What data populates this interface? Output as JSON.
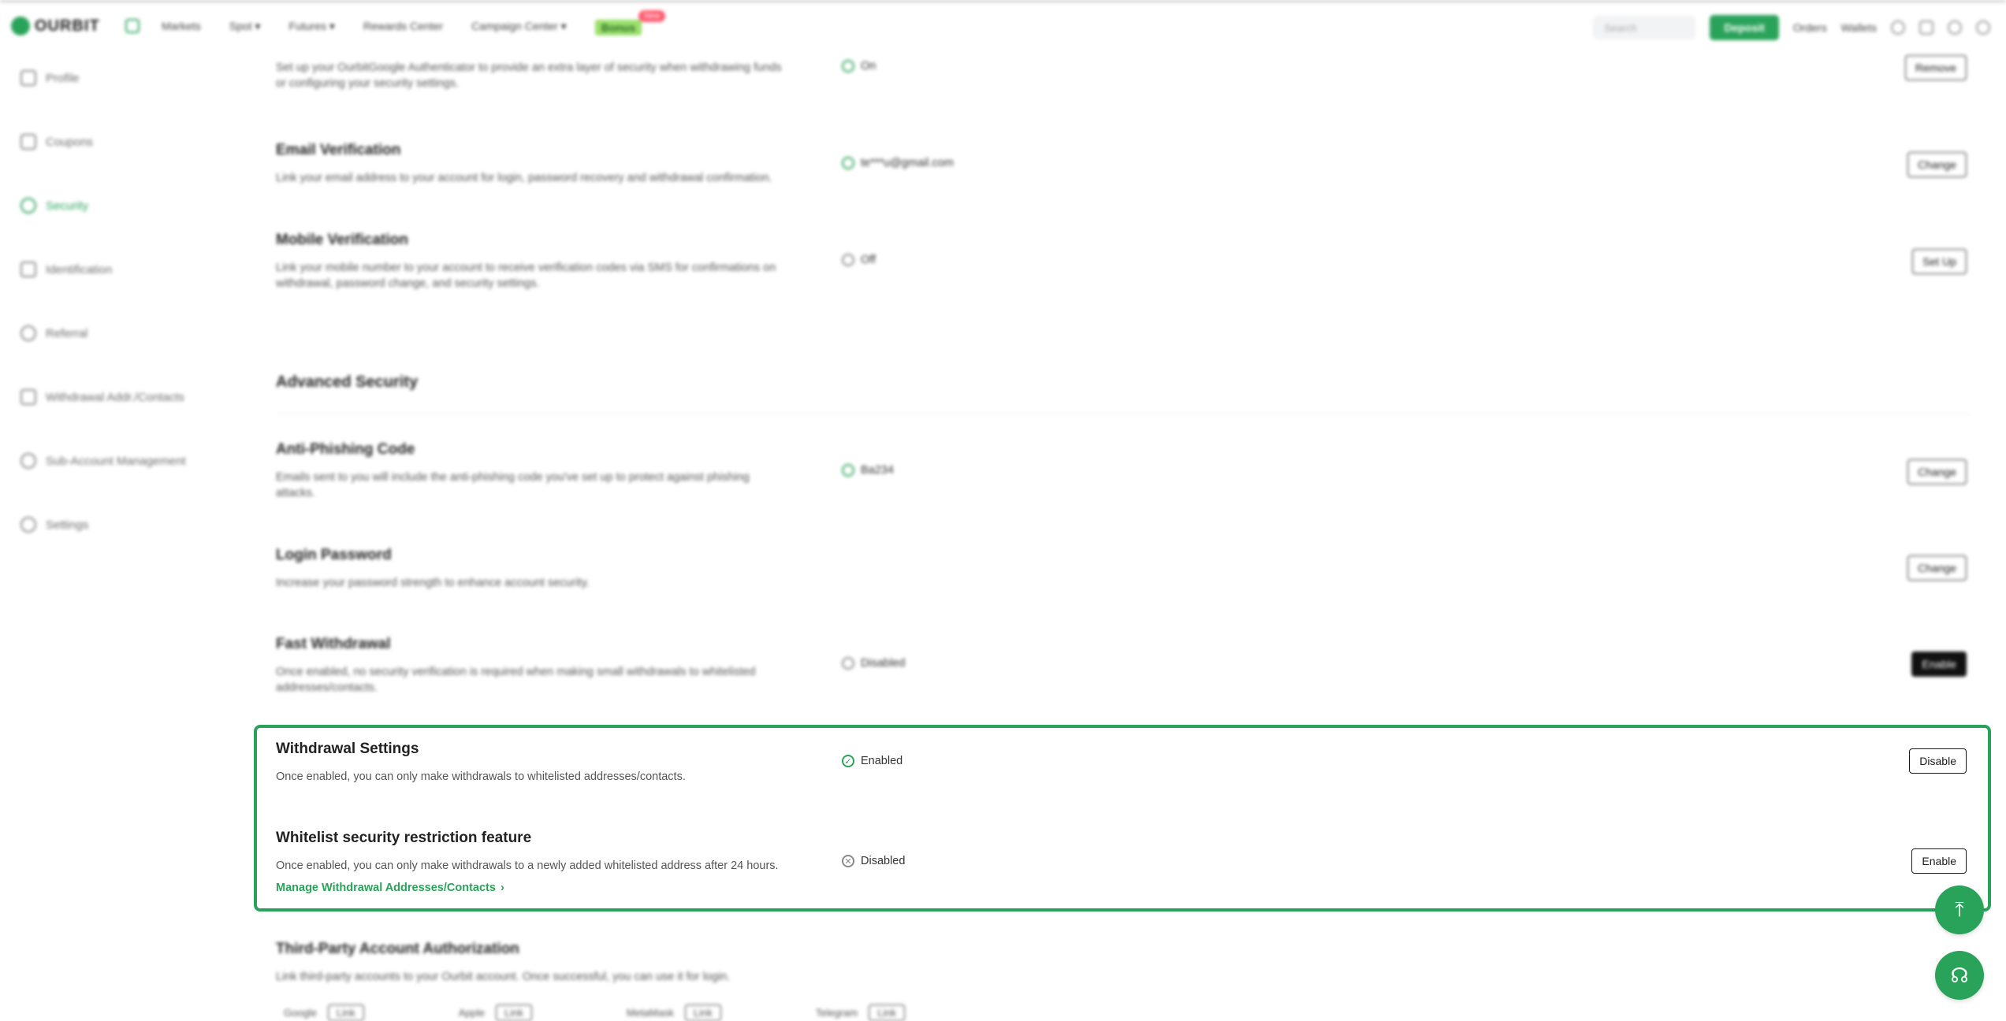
{
  "nav": {
    "logo": "OURBIT",
    "items": [
      "Markets",
      "Spot ▾",
      "Futures ▾",
      "Rewards Center",
      "Campaign Center ▾"
    ],
    "promo": "Bonus",
    "promo_badge": "New",
    "search_placeholder": "Search",
    "deposit": "Deposit",
    "orders": "Orders",
    "wallets": "Wallets"
  },
  "sidebar": {
    "items": [
      {
        "label": "Profile"
      },
      {
        "label": "Coupons"
      },
      {
        "label": "Security"
      },
      {
        "label": "Identification"
      },
      {
        "label": "Referral"
      },
      {
        "label": "Withdrawal Addr./Contacts"
      },
      {
        "label": "Sub-Account Management"
      },
      {
        "label": "Settings"
      }
    ]
  },
  "rows": {
    "authenticator": {
      "desc": "Set up your OurbitGoogle Authenticator to provide an extra layer of security when withdrawing funds or configuring your security settings.",
      "status": "On",
      "button": "Remove"
    },
    "email": {
      "title": "Email Verification",
      "desc": "Link your email address to your account for login, password recovery and withdrawal confirmation.",
      "status": "te***u@gmail.com",
      "button": "Change"
    },
    "mobile": {
      "title": "Mobile Verification",
      "desc": "Link your mobile number to your account to receive verification codes via SMS for confirmations on withdrawal, password change, and security settings.",
      "status": "Off",
      "button": "Set Up"
    },
    "advanced_title": "Advanced Security",
    "antiphishing": {
      "title": "Anti-Phishing Code",
      "desc": "Emails sent to you will include the anti-phishing code you've set up to protect against phishing attacks.",
      "status": "Ba234",
      "button": "Change"
    },
    "login_password": {
      "title": "Login Password",
      "desc": "Increase your password strength to enhance account security.",
      "button": "Change"
    },
    "fast_withdrawal": {
      "title": "Fast Withdrawal",
      "desc": "Once enabled, no security verification is required when making small withdrawals to whitelisted addresses/contacts.",
      "status": "Disabled",
      "button": "Enable"
    },
    "withdrawal_settings": {
      "title": "Withdrawal Settings",
      "desc": "Once enabled, you can only make withdrawals to whitelisted addresses/contacts.",
      "status": "Enabled",
      "button": "Disable"
    },
    "whitelist": {
      "title": "Whitelist security restriction feature",
      "desc": "Once enabled, you can only make withdrawals to a newly added whitelisted address after 24 hours.",
      "link": "Manage Withdrawal Addresses/Contacts",
      "status": "Disabled",
      "button": "Enable"
    },
    "third_party": {
      "title": "Third-Party Account Authorization",
      "desc": "Link third-party accounts to your Ourbit account. Once successful, you can use it for login.",
      "providers": [
        {
          "name": "Google",
          "action": "Link"
        },
        {
          "name": "Apple",
          "action": "Link"
        },
        {
          "name": "MetaMask",
          "action": "Link"
        },
        {
          "name": "Telegram",
          "action": "Link"
        }
      ]
    }
  }
}
